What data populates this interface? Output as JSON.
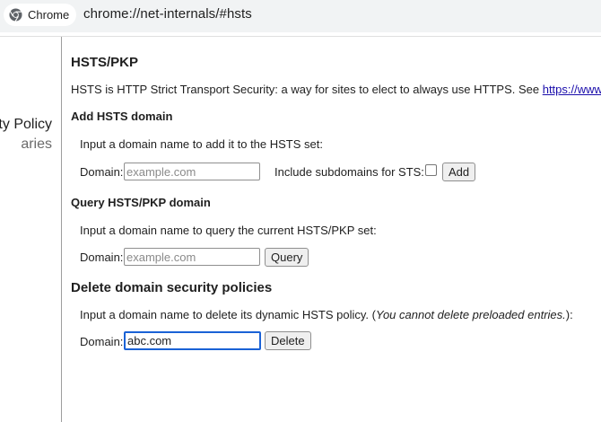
{
  "omnibox": {
    "chip_label": "Chrome",
    "url": "chrome://net-internals/#hsts"
  },
  "sidebar": {
    "items": [
      {
        "label": "ty Policy"
      },
      {
        "label": "aries"
      }
    ]
  },
  "page": {
    "title": "HSTS/PKP",
    "description_text": "HSTS is HTTP Strict Transport Security: a way for sites to elect to always use HTTPS. See ",
    "description_link": "https://www.ch"
  },
  "add_section": {
    "heading": "Add HSTS domain",
    "instruction": "Input a domain name to add it to the HSTS set:",
    "domain_label": "Domain:",
    "domain_placeholder": "example.com",
    "subdomains_label": "Include subdomains for STS:",
    "add_button": "Add"
  },
  "query_section": {
    "heading": "Query HSTS/PKP domain",
    "instruction": "Input a domain name to query the current HSTS/PKP set:",
    "domain_label": "Domain:",
    "domain_placeholder": "example.com",
    "query_button": "Query"
  },
  "delete_section": {
    "heading": "Delete domain security policies",
    "instruction_prefix": "Input a domain name to delete its dynamic HSTS policy. (",
    "instruction_italic": "You cannot delete preloaded entries.",
    "instruction_suffix": "):",
    "domain_label": "Domain:",
    "domain_value": "abc.com",
    "delete_button": "Delete"
  },
  "colors": {
    "link": "#1a0dab",
    "focus_ring": "#1a62d6",
    "omnibox_bg": "#f1f3f4"
  }
}
